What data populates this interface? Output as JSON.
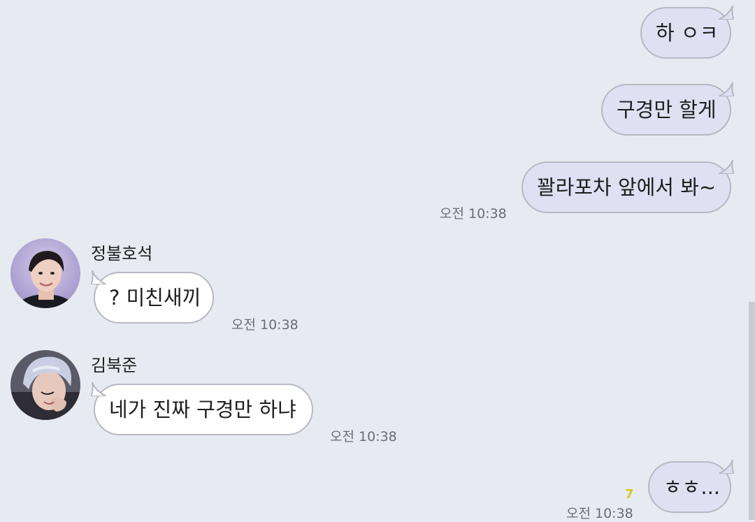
{
  "messages": [
    {
      "text": "하 ㅇㅋ",
      "direction": "outgoing"
    },
    {
      "text": "구경만 할게",
      "direction": "outgoing"
    },
    {
      "text": "꽐라포차 앞에서 봐~",
      "direction": "outgoing",
      "time": "오전 10:38"
    },
    {
      "sender": "정불호석",
      "text": "? 미친새끼",
      "direction": "incoming",
      "time": "오전 10:38",
      "avatar": "avatar-photo-hoseok"
    },
    {
      "sender": "김북준",
      "text": "네가 진짜 구경만 하냐",
      "direction": "incoming",
      "time": "오전 10:38",
      "avatar": "avatar-photo-bukjun"
    },
    {
      "text": "ㅎㅎ...",
      "direction": "outgoing",
      "time": "오전 10:38",
      "unread": "7"
    }
  ],
  "colors": {
    "background": "#e8eaf1",
    "outgoing_bubble": "#dfe0f2",
    "incoming_bubble": "#ffffff",
    "bubble_border": "#b7b8c2",
    "timestamp": "#6a6c76",
    "unread_count": "#d8c52a"
  }
}
